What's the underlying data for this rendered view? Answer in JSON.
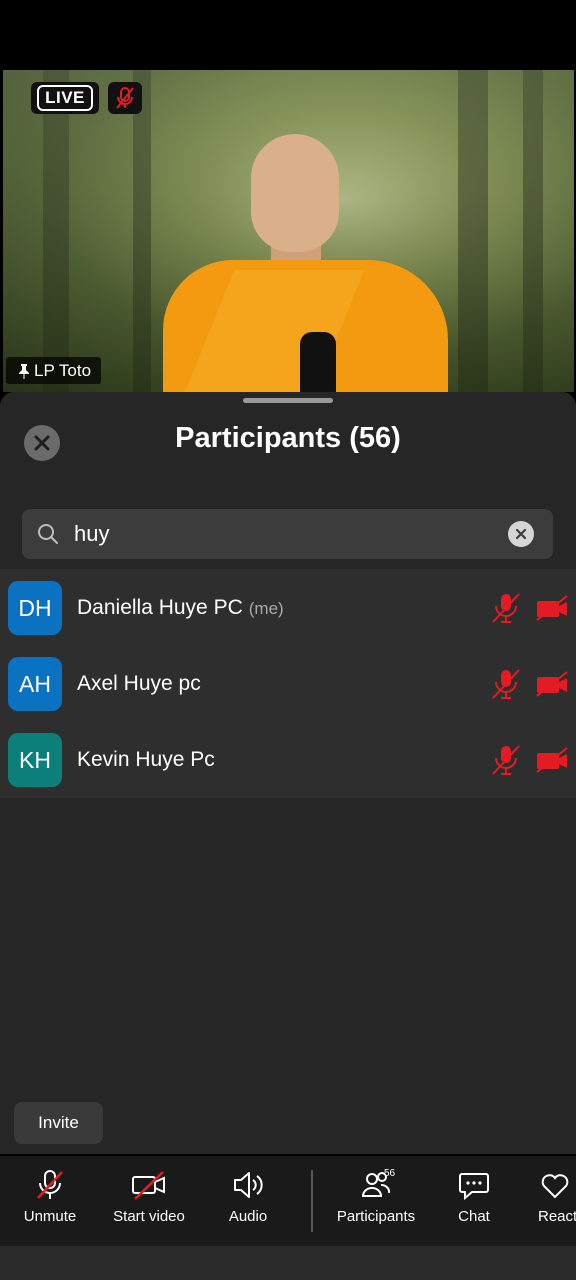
{
  "video": {
    "live_label": "LIVE",
    "speaker_name": "LP Toto"
  },
  "panel": {
    "title": "Participants (56)",
    "search_value": "huy",
    "participants": [
      {
        "initials": "DH",
        "name": "Daniella Huye PC",
        "tag": "(me)",
        "avatar_color": "#0b72c2"
      },
      {
        "initials": "AH",
        "name": "Axel Huye pc",
        "tag": "",
        "avatar_color": "#0b72c2"
      },
      {
        "initials": "KH",
        "name": "Kevin Huye Pc",
        "tag": "",
        "avatar_color": "#0d7f7a"
      }
    ],
    "invite_label": "Invite"
  },
  "toolbar": {
    "unmute": "Unmute",
    "start_video": "Start video",
    "audio": "Audio",
    "participants": "Participants",
    "participants_count": "56",
    "chat": "Chat",
    "react": "React"
  },
  "colors": {
    "muted_red": "#e51b24",
    "sheet_bg": "#262626"
  }
}
